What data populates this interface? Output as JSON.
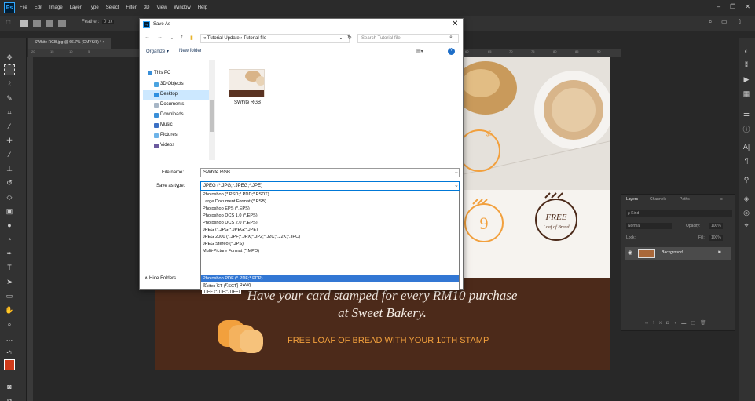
{
  "app": {
    "menu": [
      "File",
      "Edit",
      "Image",
      "Layer",
      "Type",
      "Select",
      "Filter",
      "3D",
      "View",
      "Window",
      "Help"
    ],
    "ps_logo": "Ps",
    "window_controls": [
      "–",
      "❐",
      "✕"
    ]
  },
  "options_bar": {
    "feather_label": "Feather:",
    "feather_value": "0 px"
  },
  "document_tab": {
    "title": "SWhite RGB.jpg @ 66.7% (CMYK/8) * ×"
  },
  "ruler_h": [
    "20",
    "15",
    "10",
    "5",
    "60",
    "65",
    "70",
    "75",
    "80",
    "85",
    "90",
    "95",
    "100",
    "105",
    "110"
  ],
  "artwork": {
    "stamp_numbers": [
      "9"
    ],
    "free_badge": [
      "FREE",
      "Loaf of Bread"
    ],
    "slogan_line1": "Have your card stamped for every RM10 purchase",
    "slogan_line2": "at Sweet Bakery.",
    "free_line": "FREE LOAF OF BREAD WITH YOUR 10TH STAMP"
  },
  "layers_panel": {
    "tabs": [
      "Layers",
      "Channels",
      "Paths"
    ],
    "kind_placeholder": "ρ Kind",
    "blend_mode": "Normal",
    "opacity_label": "Opacity:",
    "opacity_value": "100%",
    "lock_label": "Lock:",
    "fill_label": "Fill:",
    "fill_value": "100%",
    "layer_name": "Background"
  },
  "dialog": {
    "title": "Save As",
    "close": "✕",
    "breadcrumb": "« Tutorial Update › Tutorial file",
    "search_placeholder": "Search Tutorial file",
    "organize": "Organize ▾",
    "new_folder": "New folder",
    "nav_items": [
      "This PC",
      "3D Objects",
      "Desktop",
      "Documents",
      "Downloads",
      "Music",
      "Pictures",
      "Videos"
    ],
    "file_thumbnail_label": "SWhite RGB",
    "file_name_label": "File name:",
    "file_name_value": "SWhite RGB",
    "save_type_label": "Save as type:",
    "save_type_value": "JPEG (*.JPG;*.JPEG;*.JPE)",
    "save_types": [
      "Photoshop (*.PSD;*.PDD;*.PSDT)",
      "Large Document Format (*.PSB)",
      "Photoshop EPS (*.EPS)",
      "Photoshop DCS 1.0 (*.EPS)",
      "Photoshop DCS 2.0 (*.EPS)",
      "JPEG (*.JPG;*.JPEG;*.JPE)",
      "JPEG 2000 (*.JPF;*.JPX;*.JP2;*.J2C;*.J2K;*.JPC)",
      "JPEG Stereo (*.JPS)",
      "Multi-Picture Format (*.MPO)",
      "Photoshop PDF (*.PDF;*.PDP)",
      "Photoshop Raw (*.RAW)",
      "Scitex CT (*.SCT)",
      "TIFF (*.TIF;*.TIFF)"
    ],
    "hide_folders": "∧ Hide Folders"
  },
  "colors": {
    "accent": "#3277d4",
    "band": "#4c2a1a",
    "orange": "#f2a03d"
  }
}
